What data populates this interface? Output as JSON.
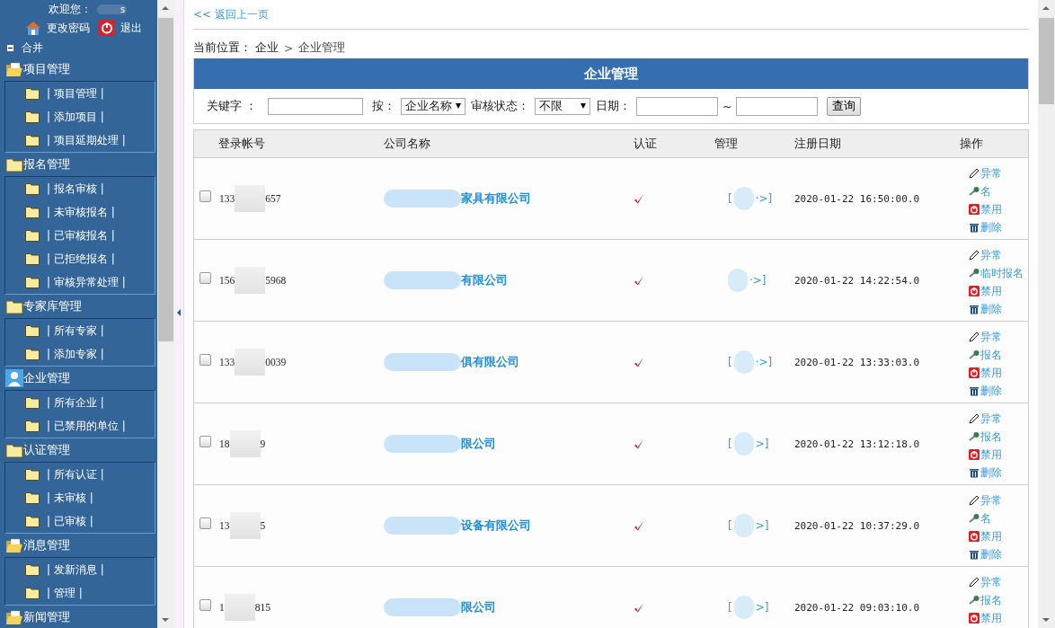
{
  "sidebar": {
    "welcome": "欢迎您：",
    "user_name": "s",
    "links": [
      {
        "kind": "password",
        "label": "更改密码"
      },
      {
        "kind": "logout",
        "label": "退出"
      }
    ],
    "collapse": {
      "label": "合并",
      "expanded": true
    },
    "groups": [
      {
        "kind": "open-folder",
        "title": "项目管理",
        "items": [
          "| 项目管理 |",
          "| 添加项目 |",
          "| 项目延期处理 |"
        ]
      },
      {
        "kind": "folder",
        "title": "报名管理",
        "items": [
          "| 报名审核 |",
          "| 未审核报名 |",
          "| 已审核报名 |",
          "| 已拒绝报名 |",
          "| 审核异常处理 |"
        ]
      },
      {
        "kind": "folder",
        "title": "专家库管理",
        "items": [
          "| 所有专家 |",
          "| 添加专家 |"
        ]
      },
      {
        "kind": "user",
        "title": "企业管理",
        "items": [
          "| 所有企业 |",
          "| 已禁用的单位 |"
        ]
      },
      {
        "kind": "folder",
        "title": "认证管理",
        "items": [
          "| 所有认证 |",
          "| 未审核 |",
          "| 已审核 |"
        ]
      },
      {
        "kind": "open-folder",
        "title": "消息管理",
        "items": [
          "| 发新消息 |",
          "| 管理 |"
        ]
      },
      {
        "kind": "open-folder",
        "title": "新闻管理"
      }
    ]
  },
  "back_link": "<< 返回上一页",
  "breadcrumb": {
    "label": "当前位置：",
    "path": [
      "企业",
      "企业管理"
    ],
    "separator": ">"
  },
  "panel": {
    "title": "企业管理",
    "filters": {
      "keyword_label": "关键字 ：",
      "by_label": "按：",
      "by_value": "企业名称",
      "status_label": "审核状态：",
      "status_value": "不限",
      "date_label": "日期：",
      "date_separator": "~",
      "query_button": "查询"
    },
    "columns": [
      "登录帐号",
      "公司名称",
      "认证",
      "管理",
      "注册日期",
      "操作"
    ],
    "rows": [
      {
        "checked": false,
        "account_start": "133",
        "account_end": "657",
        "company": "家具有限公司",
        "certified": true,
        "manage_left": "[",
        "manage_right": "·>]",
        "date": "2020-01-22 16:50:00.0",
        "actions": [
          {
            "kind": "abnormal",
            "label": "异常"
          },
          {
            "kind": "signup",
            "label": "名"
          },
          {
            "kind": "disable",
            "label": "禁用"
          },
          {
            "kind": "delete",
            "label": "删除"
          }
        ]
      },
      {
        "checked": false,
        "account_start": "156",
        "account_end": "5968",
        "company": "有限公司",
        "certified": true,
        "manage_right": "·>]",
        "date": "2020-01-22 14:22:54.0",
        "actions": [
          {
            "kind": "abnormal",
            "label": "异常"
          },
          {
            "kind": "signup",
            "label": "临时报名"
          },
          {
            "kind": "disable",
            "label": "禁用"
          },
          {
            "kind": "delete",
            "label": "删除"
          }
        ]
      },
      {
        "checked": false,
        "account_start": "133",
        "account_end": "0039",
        "company": "俱有限公司",
        "certified": true,
        "manage_left": "[",
        "manage_right": "·>]",
        "date": "2020-01-22 13:33:03.0",
        "actions": [
          {
            "kind": "abnormal",
            "label": "异常"
          },
          {
            "kind": "signup",
            "label": "报名"
          },
          {
            "kind": "disable",
            "label": "禁用"
          },
          {
            "kind": "delete",
            "label": "删除"
          }
        ]
      },
      {
        "checked": false,
        "account_start": "18",
        "account_end": "9",
        "company": "限公司",
        "certified": true,
        "manage_left": "[",
        "manage_right": ">]",
        "date": "2020-01-22 13:12:18.0",
        "actions": [
          {
            "kind": "abnormal",
            "label": "异常"
          },
          {
            "kind": "signup",
            "label": "报名"
          },
          {
            "kind": "disable",
            "label": "禁用"
          },
          {
            "kind": "delete",
            "label": "删除"
          }
        ]
      },
      {
        "checked": false,
        "account_start": "13",
        "account_end": "5",
        "company": "设备有限公司",
        "certified": true,
        "manage_left": "[",
        "manage_right": ">]",
        "date": "2020-01-22 10:37:29.0",
        "actions": [
          {
            "kind": "abnormal",
            "label": "异常"
          },
          {
            "kind": "signup",
            "label": "名"
          },
          {
            "kind": "disable",
            "label": "禁用"
          },
          {
            "kind": "delete",
            "label": "删除"
          }
        ]
      },
      {
        "checked": false,
        "account_start": "1",
        "account_end": "815",
        "company": "限公司",
        "certified": true,
        "manage_left": "[",
        "manage_right": ">]",
        "date": "2020-01-22 09:03:10.0",
        "actions": [
          {
            "kind": "abnormal",
            "label": "异常"
          },
          {
            "kind": "signup",
            "label": "报名"
          },
          {
            "kind": "disable",
            "label": "禁用"
          }
        ]
      }
    ]
  }
}
